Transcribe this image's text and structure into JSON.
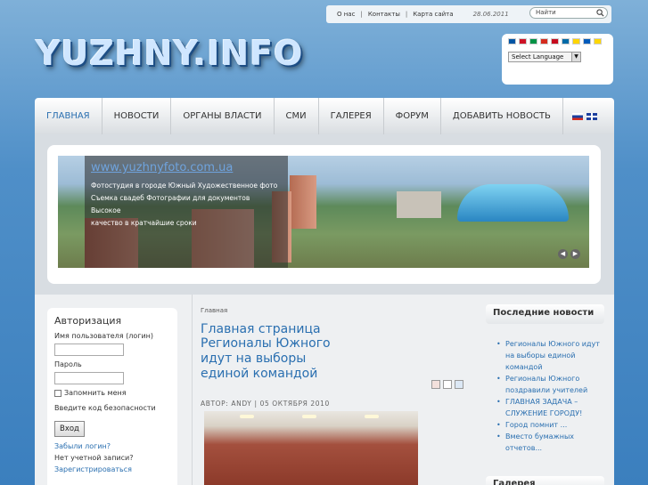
{
  "topbar": {
    "links": [
      "О нас",
      "Контакты",
      "Карта сайта"
    ],
    "date": "28.06.2011",
    "search_placeholder": "Найти"
  },
  "logo": "YUZHNY.INFO",
  "language": {
    "select_label": "Select Language",
    "flag_colors": [
      "#0055a4",
      "#ce1126",
      "#009246",
      "#d52b1e",
      "#c60b1e",
      "#006aa7",
      "#ffd500",
      "#005bbb",
      "#ffd700"
    ]
  },
  "nav": {
    "items": [
      "ГЛАВНАЯ",
      "НОВОСТИ",
      "ОРГАНЫ ВЛАСТИ",
      "СМИ",
      "ГАЛЕРЕЯ",
      "ФОРУМ",
      "ДОБАВИТЬ НОВОСТЬ"
    ],
    "active": "ГЛАВНАЯ"
  },
  "banner": {
    "url_text": "www.yuzhnyfoto.com.ua",
    "lines": [
      "Фотостудия в городе Южный Художественное фото",
      "Съемка свадеб Фотографии для документов Высокое",
      "качество в кратчайшие сроки"
    ]
  },
  "login": {
    "title": "Авторизация",
    "username_label": "Имя пользователя (логин)",
    "password_label": "Пароль",
    "remember_label": "Запомнить меня",
    "security_label": "Введите код безопасности",
    "submit_label": "Вход",
    "forgot_link": "Забыли логин?",
    "no_account": "Нет учетной записи?",
    "register_link": "Зарегистрироваться"
  },
  "main": {
    "breadcrumb": "Главная",
    "page_title": "Главная страница",
    "article_title": "Регионалы Южного идут на выборы единой командой",
    "meta": "АВТОР: ANDY | 05 ОКТЯБРЯ 2010"
  },
  "sidebar": {
    "latest_title": "Последние новости",
    "latest": [
      "Регионалы Южного идут на выборы единой командой",
      "Регионалы Южного поздравили учителей",
      "ГЛАВНАЯ ЗАДАЧА – СЛУЖЕНИЕ ГОРОДУ!",
      "Город помнит ...",
      "Вместо бумажных отчетов..."
    ],
    "gallery_title": "Галерея"
  }
}
